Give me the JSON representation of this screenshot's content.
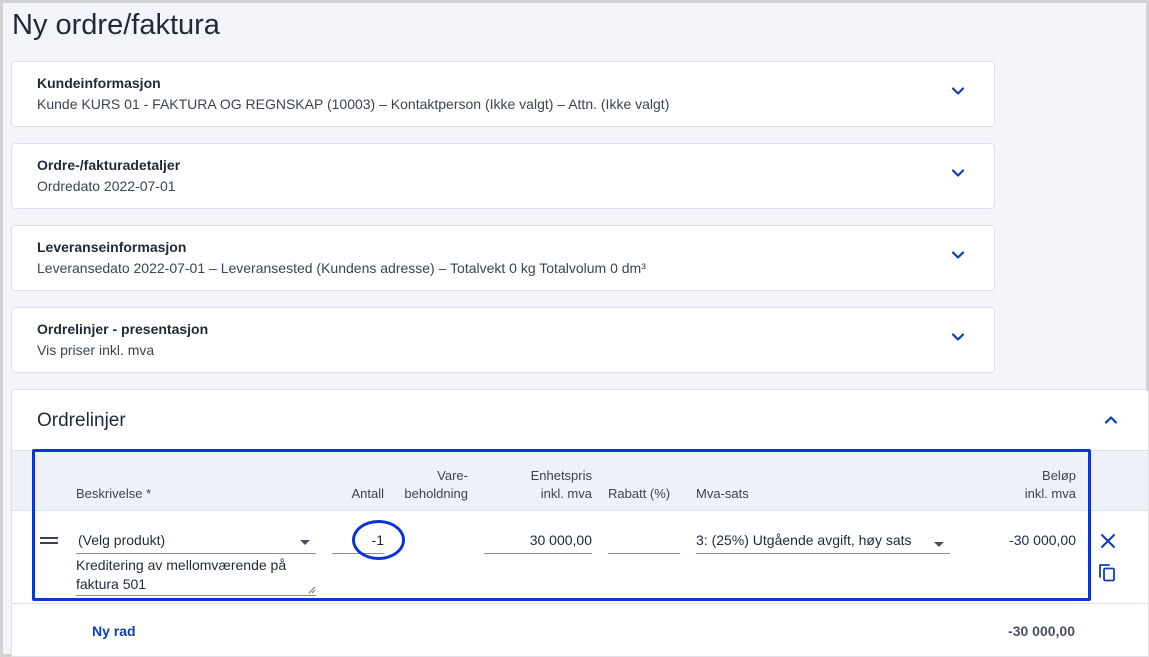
{
  "page": {
    "title": "Ny ordre/faktura"
  },
  "sections": [
    {
      "title": "Kundeinformasjon",
      "summary": "Kunde KURS 01 - FAKTURA OG REGNSKAP (10003)  –  Kontaktperson (Ikke valgt)  –  Attn. (Ikke valgt)"
    },
    {
      "title": "Ordre-/fakturadetaljer",
      "summary": "Ordredato 2022-07-01"
    },
    {
      "title": "Leveranseinformasjon",
      "summary": "Leveransedato 2022-07-01  –  Leveransested (Kundens adresse)  –  Totalvekt 0 kg Totalvolum 0 dm³"
    },
    {
      "title": "Ordrelinjer - presentasjon",
      "summary": "Vis priser inkl. mva"
    }
  ],
  "orderlines": {
    "title": "Ordrelinjer",
    "columns": {
      "description": "Beskrivelse *",
      "quantity": "Antall",
      "stock_1": "Vare-",
      "stock_2": "beholdning",
      "unit_price_1": "Enhetspris",
      "unit_price_2": "inkl. mva",
      "discount": "Rabatt (%)",
      "vat": "Mva-sats",
      "amount_1": "Beløp",
      "amount_2": "inkl. mva"
    },
    "row": {
      "product": "(Velg produkt)",
      "description": "Kreditering av mellomværende på faktura 501",
      "quantity": "-1",
      "stock": "",
      "unit_price": "30 000,00",
      "discount": "",
      "vat": "3: (25%) Utgående avgift, høy sats",
      "amount": "-30 000,00"
    },
    "new_row_label": "Ny rad",
    "total": "-30 000,00"
  },
  "icons": {
    "expand": "chevron-down-icon",
    "collapse": "chevron-up-icon",
    "delete": "close-icon",
    "copy": "copy-icon",
    "drag": "drag-handle-icon"
  },
  "colors": {
    "accent": "#0b3fb8",
    "highlight": "#0a34d6"
  }
}
